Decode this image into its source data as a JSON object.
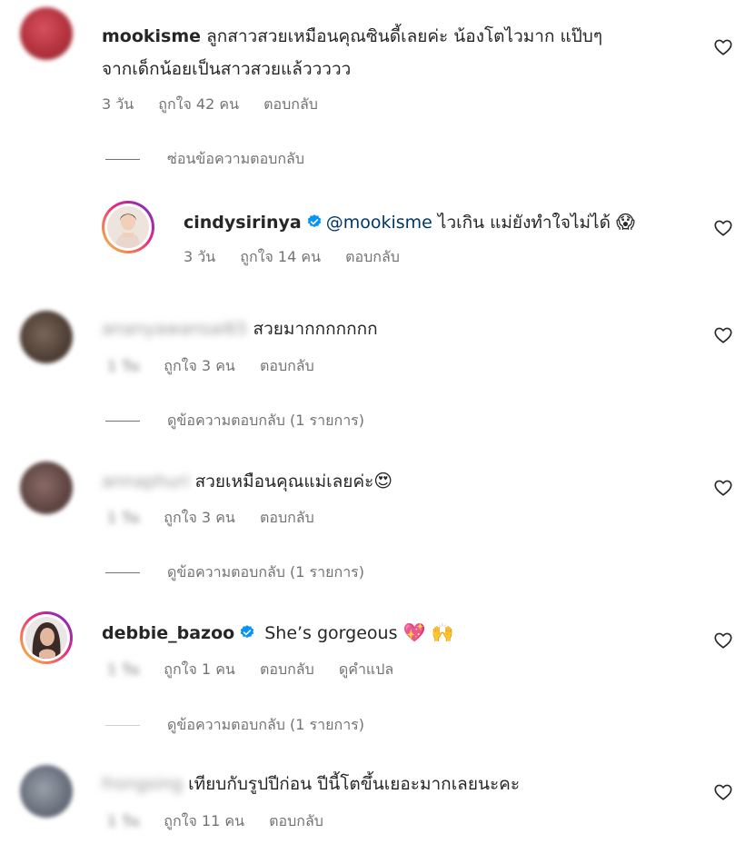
{
  "comments": [
    {
      "username": "mookisme",
      "text_line1": "ลูกสาวสวยเหมือนคุณซินดี้เลยค่ะ น้องโตไวมาก แป๊บๆ",
      "text_line2": "จากเด็กน้อยเป็นสาวสวยแล้ววววว",
      "time": "3 วัน",
      "likes": "ถูกใจ 42 คน",
      "reply": "ตอบกลับ",
      "toggle": "ซ่อนข้อความตอบกลับ"
    },
    {
      "username": "cindysirinya",
      "mention": "@mookisme",
      "text": " ไวเกิน แม่ยังทำใจไม่ได้ ",
      "emoji": "😱",
      "time": "3 วัน",
      "likes": "ถูกใจ 14 คน",
      "reply": "ตอบกลับ"
    },
    {
      "username": "ananyawansai65",
      "text": " สวยมากกกกกกก",
      "time": "1 วัน",
      "likes": "ถูกใจ 3 คน",
      "reply": "ตอบกลับ",
      "toggle": "ดูข้อความตอบกลับ (1 รายการ)"
    },
    {
      "username": "annaphuri",
      "text": " สวยเหมือนคุณแม่เลยค่ะ",
      "emoji": "😍",
      "time": "1 วัน",
      "likes": "ถูกใจ 3 คน",
      "reply": "ตอบกลับ",
      "toggle": "ดูข้อความตอบกลับ (1 รายการ)"
    },
    {
      "username": "debbie_bazoo",
      "text": " She’s gorgeous ",
      "emoji": "💖 🙌",
      "time": "1 วัน",
      "likes": "ถูกใจ 1 คน",
      "reply": "ตอบกลับ",
      "translate": "ดูคำแปล",
      "toggle": "ดูข้อความตอบกลับ (1 รายการ)"
    },
    {
      "username": "frongsing",
      "text": " เทียบกับรูปปีก่อน ปีนี้โตขึ้นเยอะมากเลยนะคะ",
      "time": "1 วัน",
      "likes": "ถูกใจ 11 คน",
      "reply": "ตอบกลับ"
    }
  ],
  "colors": {
    "text": "#262626",
    "secondary": "#737373",
    "mention": "#00376b",
    "verified": "#0095f6"
  }
}
